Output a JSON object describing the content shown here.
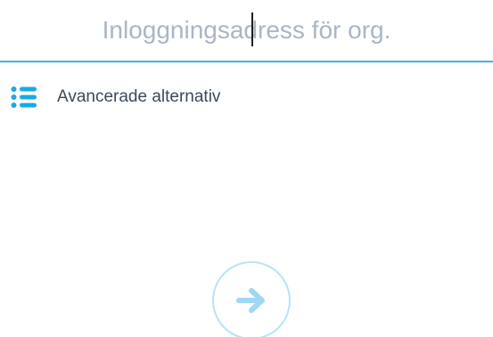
{
  "signin": {
    "address_placeholder": "Inloggningsadress för org.",
    "address_value": ""
  },
  "advanced": {
    "label": "Avancerade alternativ",
    "icon": "list-icon"
  },
  "next_button": {
    "icon": "arrow-right-icon"
  },
  "colors": {
    "accent": "#42b6d8",
    "icon_blue": "#1aa9e6",
    "next_border": "#b8e3f4",
    "next_arrow": "#9fd8f0",
    "placeholder": "#a9b6c4"
  }
}
